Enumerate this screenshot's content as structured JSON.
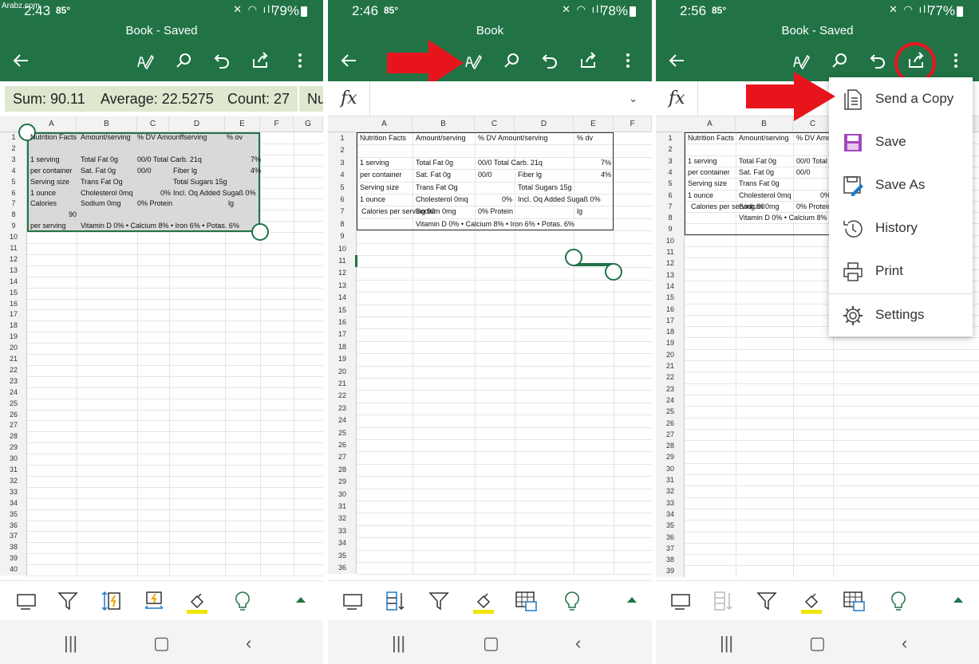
{
  "watermark": "Arabz.com",
  "panels": [
    {
      "time": "2:43",
      "temp": "85°",
      "battery": "79%",
      "title": "Book - Saved",
      "summary": [
        "Sum: 90.11",
        "Average: 22.5275",
        "Count: 27",
        "Nu"
      ],
      "columns": [
        "A",
        "B",
        "C",
        "D",
        "E",
        "F",
        "G"
      ],
      "rows": [
        "1",
        "2",
        "3",
        "4",
        "5",
        "6",
        "7",
        "8",
        "9",
        "10",
        "11",
        "12",
        "13",
        "14",
        "15",
        "16",
        "17",
        "18",
        "19",
        "20",
        "21",
        "22",
        "23",
        "24",
        "25",
        "26",
        "27",
        "28",
        "29",
        "30",
        "31",
        "32",
        "33",
        "34",
        "35",
        "36",
        "37",
        "38",
        "39",
        "40"
      ],
      "cells": {
        "r1": [
          "Nutrition Facts",
          "Amount/serving",
          "% DV Amounffserving",
          "% ov"
        ],
        "r3": [
          "1 serving",
          "Total Fat 0g",
          "00/0 Total Carb. 21q",
          "7%"
        ],
        "r4": [
          "per container",
          "Sat. Fat 0g",
          "00/0",
          "Fiber lg",
          "4%"
        ],
        "r5": [
          "Serving size",
          "Trans Fat Og",
          "Total Sugars 15g"
        ],
        "r6": [
          "1 ounce",
          "Cholesterol 0mq",
          "0%",
          "Incl. Oq Added Sugaß 0%"
        ],
        "r7": [
          "Calories",
          "Sodium 0mg",
          "0% Protein",
          "lg"
        ],
        "r8": [
          "90"
        ],
        "r9": [
          "per serving",
          "Vitamin D 0% • Calcium 8% • Iron 6% • Potas. 6%"
        ]
      }
    },
    {
      "time": "2:46",
      "temp": "85°",
      "battery": "78%",
      "title": "Book",
      "fx": "fx",
      "columns": [
        "A",
        "B",
        "C",
        "D",
        "E",
        "F"
      ],
      "rows": [
        "1",
        "2",
        "3",
        "4",
        "5",
        "6",
        "7",
        "8",
        "9",
        "10",
        "11",
        "12",
        "13",
        "14",
        "15",
        "16",
        "17",
        "18",
        "19",
        "20",
        "21",
        "22",
        "23",
        "24",
        "25",
        "26",
        "27",
        "28",
        "29",
        "30",
        "31",
        "32",
        "33",
        "34",
        "35",
        "36"
      ],
      "cells": {
        "r1": [
          "Nutrition Facts",
          "Amount/serving",
          "% DV Amount/serving",
          "% dv"
        ],
        "r3": [
          "1 serving",
          "Total Fat 0g",
          "00/0 Total Carb. 21q",
          "7%"
        ],
        "r4": [
          "per container",
          "Sat. Fat 0g",
          "00/0",
          "Fiber lg",
          "4%"
        ],
        "r5": [
          "Serving size",
          "Trans Fat Og",
          "Total Sugars 15g"
        ],
        "r6": [
          "1 ounce",
          "Cholesterol 0mq",
          "0%",
          "Incl. Oq Added Sugaß 0%"
        ],
        "r7": [
          "Calories per serving 90",
          "Sodium 0mg",
          "0% Protein",
          "lg"
        ],
        "r8": [
          "Vitamin D 0% • Calcium 8% • Iron 6% • Potas. 6%"
        ]
      }
    },
    {
      "time": "2:56",
      "temp": "85°",
      "battery": "77%",
      "title": "Book - Saved",
      "fx": "fx",
      "columns": [
        "A",
        "B",
        "C"
      ],
      "rows": [
        "1",
        "2",
        "3",
        "4",
        "5",
        "6",
        "7",
        "8",
        "9",
        "10",
        "11",
        "12",
        "13",
        "14",
        "15",
        "16",
        "17",
        "18",
        "19",
        "20",
        "21",
        "22",
        "23",
        "24",
        "25",
        "26",
        "27",
        "28",
        "29",
        "30",
        "31",
        "32",
        "33",
        "34",
        "35",
        "36",
        "37",
        "38",
        "39"
      ],
      "cells": {
        "r1": [
          "Nutrition Facts",
          "Amount/serving",
          "% DV Amou"
        ],
        "r3": [
          "1 serving",
          "Total Fat 0g",
          "00/0 Total"
        ],
        "r4": [
          "per container",
          "Sat. Fat 0g",
          "00/0"
        ],
        "r5": [
          "Serving size",
          "Trans Fat 0g"
        ],
        "r6": [
          "1 ounce",
          "Cholesterol 0mq",
          "0%"
        ],
        "r7": [
          "Calories per serving 90",
          "Sodium 0mg",
          "0% Protein"
        ],
        "r8": [
          "Vitamin D 0% • Calcium 8% •"
        ]
      },
      "menu": [
        "Send a Copy",
        "Save",
        "Save As",
        "History",
        "Print",
        "Settings"
      ]
    }
  ],
  "colors": {
    "excel_green": "#217346",
    "arrow_red": "#e8141c",
    "chip_bg": "#dde8cf",
    "highlight_yellow": "#f0e600"
  }
}
